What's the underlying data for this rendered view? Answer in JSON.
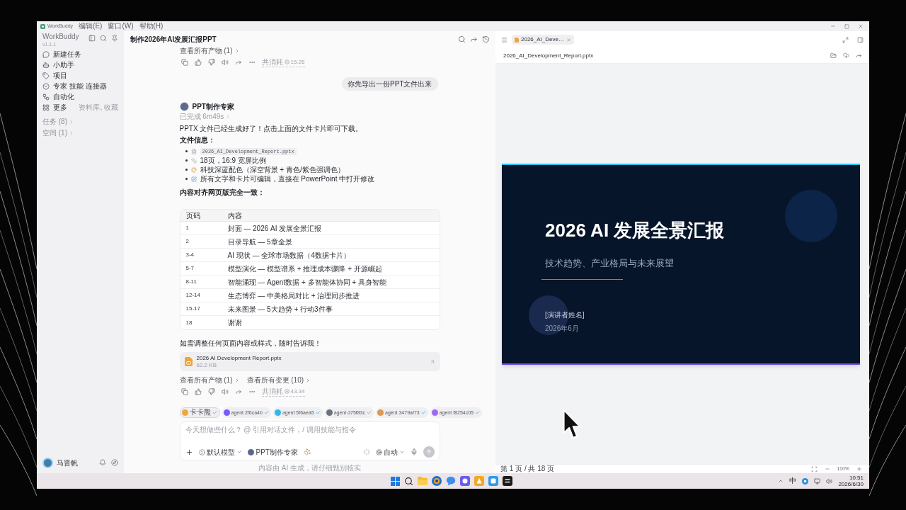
{
  "titlebar": {
    "app_name": "WorkBuddy",
    "menus": [
      "编辑(E)",
      "窗口(W)",
      "帮助(H)"
    ]
  },
  "sidebar": {
    "title": "WorkBuddy",
    "version": "v1.1.1",
    "items": [
      {
        "label": "新建任务"
      },
      {
        "label": "小助手"
      },
      {
        "label": "项目"
      },
      {
        "label": "专家 技能 连接器"
      },
      {
        "label": "自动化"
      },
      {
        "label": "更多",
        "hint": "资料库, 收藏"
      }
    ],
    "groups": [
      "任务 (8)",
      "空间 (1)"
    ],
    "user": {
      "name": "马晋帆"
    }
  },
  "chat": {
    "title": "制作2026年AI发展汇报PPT",
    "earlier_reply": {
      "link": "查看所有产物 (1)",
      "usage_label": "共消耗",
      "credits": "15.26"
    },
    "user_message": "你先导出一份PPT文件出来",
    "reply": {
      "agent": "PPT制作专家",
      "status": "已完成 6m49s",
      "intro": "PPTX 文件已经生成好了！点击上面的文件卡片即可下载。",
      "info_heading": "文件信息：",
      "info_items": [
        {
          "kind": "code",
          "text": "2026_AI_Development_Report.pptx"
        },
        {
          "kind": "text",
          "text": "18页，16:9 宽屏比例"
        },
        {
          "kind": "text",
          "text": "科技深蓝配色（深空背景 + 青色/紫色强调色）"
        },
        {
          "kind": "text",
          "text": "所有文字和卡片可编辑，直接在 PowerPoint 中打开修改"
        }
      ],
      "table_heading": "内容对齐网页版完全一致：",
      "table": {
        "columns": [
          "页码",
          "内容"
        ],
        "rows": [
          [
            "1",
            "封面 — 2026 AI 发展全景汇报"
          ],
          [
            "2",
            "目录导航 — 5章全景"
          ],
          [
            "3-4",
            "AI 现状 — 全球市场数据（4数据卡片）"
          ],
          [
            "5-7",
            "模型演化 — 模型谱系 + 推理成本骤降 + 开源崛起"
          ],
          [
            "8-11",
            "智能涌现 — Agent数据 + 多智能体协同 + 具身智能"
          ],
          [
            "12-14",
            "生态博弈 — 中美格局对比 + 治理同步推进"
          ],
          [
            "15-17",
            "未来图景 — 5大趋势 + 行动3件事"
          ],
          [
            "18",
            "谢谢"
          ]
        ]
      },
      "closing": "如需调整任何页面内容或样式，随时告诉我！",
      "file": {
        "name": "2026 AI Development Report.pptx",
        "size": "62.2 KB"
      },
      "links": [
        "查看所有产物 (1)",
        "查看所有变更 (10)"
      ],
      "usage_label": "共消耗",
      "credits": "43.34"
    },
    "agents": [
      {
        "kind": "main",
        "name": "卡卡熊",
        "color": "#f0a73a",
        "checked": true
      },
      {
        "kind": "agent",
        "name": "agent 2f6ca4b",
        "color": "#7b5cf5",
        "checked": true
      },
      {
        "kind": "agent",
        "name": "agent 5f6aea5",
        "color": "#2fb8f0",
        "checked": true
      },
      {
        "kind": "agent",
        "name": "agent d75f83c",
        "color": "#6b7280",
        "checked": true
      },
      {
        "kind": "agent",
        "name": "agent 3479af73",
        "color": "#d99a55",
        "checked": true
      },
      {
        "kind": "agent",
        "name": "agent f8254c05",
        "color": "#9b6cf0",
        "checked": true
      }
    ],
    "composer": {
      "placeholder": "今天想做些什么？ @ 引用对话文件，/ 调用技能与指令",
      "model": "默认模型",
      "agent": "PPT制作专家",
      "mode": "自动"
    },
    "disclaimer": "内容由 AI 生成，请仔细甄别核实"
  },
  "preview": {
    "tabs": [
      {
        "label": "2026_AI_Deve…",
        "selected": true
      }
    ],
    "file_title": "2026_AI_Development_Report.pptx",
    "slide": {
      "title": "2026 AI 发展全景汇报",
      "subtitle": "技术趋势、产业格局与未来展望",
      "presenter": "[演讲者姓名]",
      "date": "2026年6月"
    },
    "page_status": "第 1 页 / 共 18 页",
    "zoom": "110%"
  },
  "taskbar": {
    "ime": "中",
    "time": "10:51",
    "date": "2026/6/30"
  }
}
